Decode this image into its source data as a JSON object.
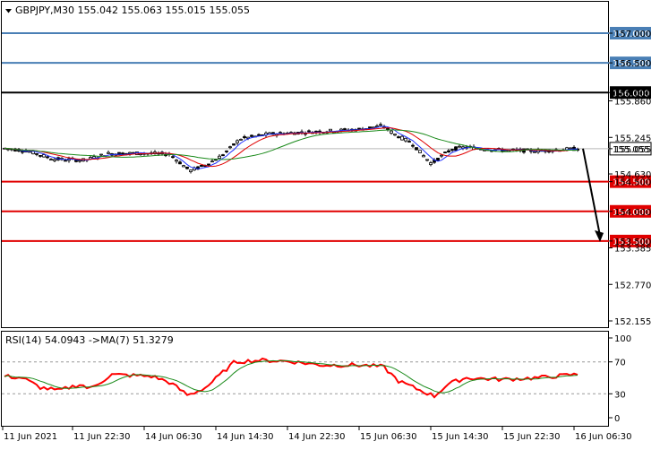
{
  "header": {
    "menu_icon": "triangle-down-icon",
    "title": "GBPJPY,M30  155.042 155.063 155.015 155.055"
  },
  "rsi_header": "RSI(14) 54.0943  ->MA(7) 51.3279",
  "colors": {
    "blue_level": "#4a7fb5",
    "red_level": "#e00000",
    "black_level": "#000000",
    "ma_red": "#e00000",
    "ma_green": "#1a8a1a",
    "ma_blue": "#2030ff",
    "rsi_line": "#ff0000",
    "rsi_ma": "#1a8a1a"
  },
  "price_axis": {
    "ticks": [
      "157.000",
      "156.500",
      "156.000",
      "155.860",
      "155.245",
      "155.055",
      "154.630",
      "154.500",
      "154.000",
      "153.500",
      "153.385",
      "152.770",
      "152.155"
    ],
    "tick_values": [
      157.0,
      156.5,
      156.0,
      155.86,
      155.245,
      155.055,
      154.63,
      154.5,
      154.0,
      153.5,
      153.385,
      152.77,
      152.155
    ]
  },
  "levels": [
    {
      "value": 157.0,
      "label": "157.000",
      "kind": "blue"
    },
    {
      "value": 156.5,
      "label": "156.500",
      "kind": "blue"
    },
    {
      "value": 156.0,
      "label": "156.000",
      "kind": "black"
    },
    {
      "value": 154.5,
      "label": "154.500",
      "kind": "red"
    },
    {
      "value": 154.0,
      "label": "154.000",
      "kind": "red"
    },
    {
      "value": 153.5,
      "label": "153.500",
      "kind": "red"
    }
  ],
  "current_price": {
    "value": 155.055,
    "label": "155.055"
  },
  "rsi_axis": {
    "ticks": [
      "100",
      "70",
      "30",
      "0"
    ],
    "tick_values": [
      100,
      70,
      30,
      0
    ]
  },
  "time_axis": [
    "11 Jun 2021",
    "11 Jun 22:30",
    "14 Jun 06:30",
    "14 Jun 14:30",
    "14 Jun 22:30",
    "15 Jun 06:30",
    "15 Jun 14:30",
    "15 Jun 22:30",
    "16 Jun 06:30"
  ],
  "chart_data": {
    "type": "line",
    "title": "GBPJPY,M30",
    "ohlc": {
      "open": 155.042,
      "high": 155.063,
      "low": 155.015,
      "close": 155.055
    },
    "x": [
      "11 Jun 2021",
      "11 Jun 22:30",
      "14 Jun 06:30",
      "14 Jun 14:30",
      "14 Jun 22:30",
      "15 Jun 06:30",
      "15 Jun 14:30",
      "15 Jun 22:30",
      "16 Jun 06:30"
    ],
    "series": [
      {
        "values": [
          155.05,
          154.95,
          154.6,
          155.3,
          155.38,
          155.45,
          155.06,
          155.02,
          155.055
        ]
      }
    ],
    "ylim": [
      152.1,
      157.1
    ],
    "forecast_arrow": {
      "from": 155.055,
      "to": 153.5
    },
    "rsi": {
      "ylim": [
        0,
        100
      ],
      "levels": [
        70,
        30
      ],
      "values": [
        52,
        42,
        35,
        48,
        25,
        72,
        65,
        40,
        28,
        50,
        48,
        50,
        54
      ]
    }
  }
}
